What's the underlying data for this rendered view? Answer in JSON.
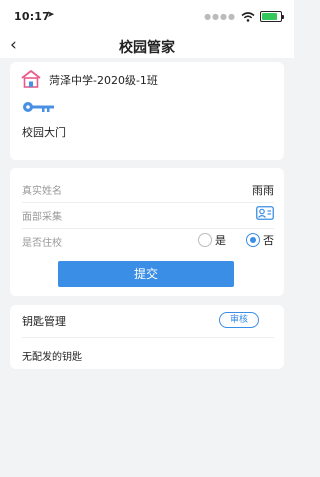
{
  "status_bar": {
    "time": "10:17",
    "location_glyph": "➤"
  },
  "nav": {
    "back_glyph": "‹",
    "title": "校园管家"
  },
  "school": {
    "name": "菏泽中学-2020级-1班",
    "gate_label": "校园大门"
  },
  "form": {
    "real_name_label": "真实姓名",
    "real_name_value": "雨雨",
    "face_label": "面部采集",
    "residence_label": "是否住校",
    "option_yes": "是",
    "option_no": "否",
    "selected": "否",
    "submit_label": "提交"
  },
  "keys": {
    "title": "钥匙管理",
    "audit_label": "审核",
    "empty_text": "无配发的钥匙"
  },
  "colors": {
    "accent": "#3a8ee6",
    "icon_pink": "#e85d8e",
    "icon_blue": "#4a90e2"
  }
}
